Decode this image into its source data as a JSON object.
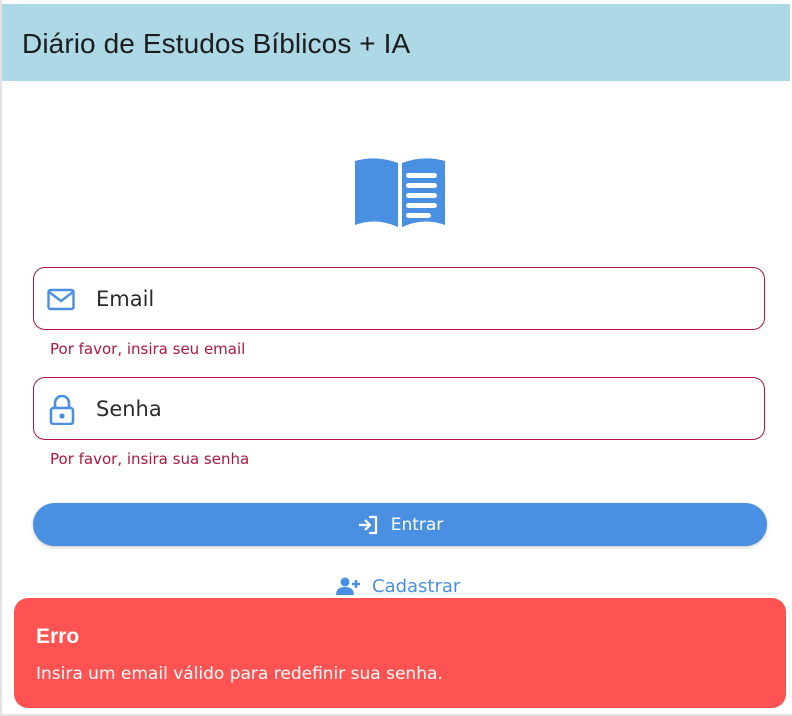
{
  "app": {
    "title": "Diário de Estudos Bíblicos + IA"
  },
  "colors": {
    "appbar": "#add8e6",
    "accent": "#4a90e2",
    "error": "#b0163f",
    "toast": "#ff5252"
  },
  "form": {
    "email": {
      "placeholder": "Email",
      "value": "",
      "icon": "mail-icon",
      "error": "Por favor, insira seu email"
    },
    "password": {
      "placeholder": "Senha",
      "value": "",
      "icon": "lock-icon",
      "error": "Por favor, insira sua senha"
    },
    "submit_label": "Entrar",
    "submit_icon": "login-icon",
    "register_label": "Cadastrar",
    "register_icon": "person-add-icon"
  },
  "toast": {
    "title": "Erro",
    "message": "Insira um email válido para redefinir sua senha."
  }
}
